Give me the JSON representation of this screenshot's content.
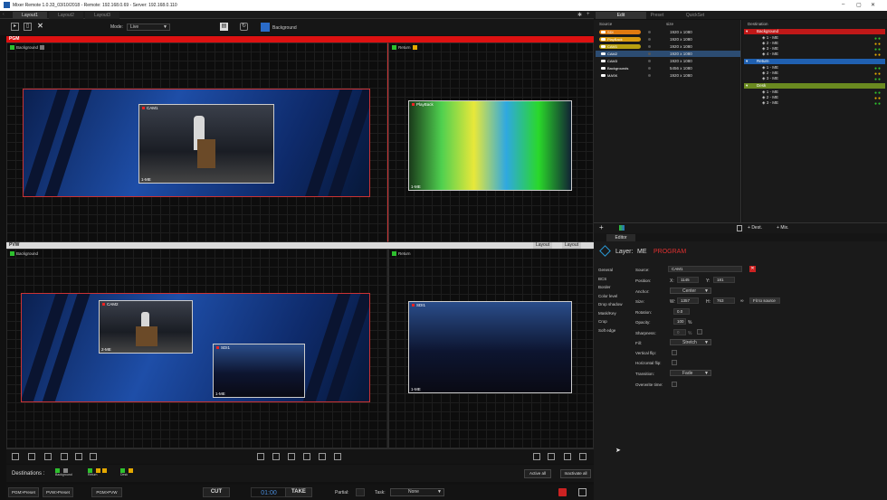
{
  "titlebar": {
    "title": "Mixer Remote 1.0.33_03/10/2018 - Remote: 192.168.0.69 - Server: 192.168.0.110",
    "minimize": "–",
    "maximize": "▢",
    "close": "✕"
  },
  "layout_tabs": [
    "Layout1",
    "Layout2",
    "Layout3"
  ],
  "right_tabs": [
    "Edit",
    "Preset",
    "QuickSet"
  ],
  "toolbar": {
    "mode_label": "Mode:",
    "mode_value": "Live",
    "bg_label": "Background"
  },
  "pgm": {
    "label": "PGM",
    "left_pane": {
      "label": "Background"
    },
    "right_pane": {
      "label": "Return"
    },
    "layers": [
      {
        "name": "CAM1",
        "me": "1-ME"
      },
      {
        "name": "PlayBack",
        "me": "1-ME"
      }
    ]
  },
  "pvw": {
    "label": "PVW",
    "layout_btn": "Layout",
    "layout_btn2": "Layout",
    "left_pane": {
      "label": "Background"
    },
    "right_pane": {
      "label": "Return"
    },
    "layers": [
      {
        "name": "CAM2",
        "me": "2-ME"
      },
      {
        "name": "SDI1",
        "me": "1-ME"
      },
      {
        "name": "SDI1",
        "me": "1-ME"
      }
    ]
  },
  "destinations_bar": {
    "label": "Destinations :",
    "items": [
      "Background",
      "Return",
      "Desk"
    ],
    "active_all": "Active all",
    "inactivate_all": "Inactivate all"
  },
  "actions": {
    "pgm_preset": "PGM>Preset",
    "pvw_preset": "PVW>Preset",
    "pgm_pvw": "PGM>PVW",
    "cut": "CUT",
    "timer": "01:00",
    "take": "TAKE",
    "partial": "Partial:",
    "task": "Task:",
    "task_value": "None"
  },
  "sources": {
    "header_source": "Source",
    "header_size": "size",
    "rows": [
      {
        "name": "SDI",
        "size": "1920 x 1080",
        "color": "#e07a10",
        "pill": true
      },
      {
        "name": "PlayBack",
        "size": "1920 x 1080",
        "color": "#d89a10",
        "pill": true
      },
      {
        "name": "CAM1",
        "size": "1920 x 1080",
        "color": "#b8a010",
        "pill": true
      },
      {
        "name": "CAM2",
        "size": "1920 x 1080",
        "color": "#2c4c72",
        "pill": false
      },
      {
        "name": "CAM3",
        "size": "1920 x 1080",
        "color": "",
        "pill": false
      },
      {
        "name": "Backgrounds",
        "size": "5456 x 1080",
        "color": "",
        "pill": false
      },
      {
        "name": "MASK",
        "size": "1920 x 1080",
        "color": "",
        "pill": false
      }
    ]
  },
  "destinations_tree": {
    "header": "Destination",
    "groups": [
      {
        "name": "Background",
        "color": "#c01818",
        "items": [
          "1 - ME",
          "2 - ME",
          "3 - ME",
          "4 - ME"
        ]
      },
      {
        "name": "Return",
        "color": "#2060b0",
        "items": [
          "1 - ME",
          "2 - ME",
          "3 - ME"
        ]
      },
      {
        "name": "Desk",
        "color": "#6a8a20",
        "items": [
          "1 - ME",
          "2 - ME",
          "3 - ME"
        ]
      }
    ]
  },
  "panel_bottom": {
    "dest_btn": "Dest.",
    "mix_btn": "Mix."
  },
  "editor_tab": "Editor",
  "editor": {
    "layer_label": "Layer:",
    "layer_me": "ME",
    "layer_state": "PROGRAM",
    "state_color": "#e03030",
    "sections": [
      "General",
      "BCS",
      "Border",
      "Color level",
      "Drop shadow",
      "Mask/Key",
      "Crop",
      "Soft edge"
    ],
    "source_label": "Source:",
    "source_value": "CAM1",
    "position_label": "Position:",
    "x_label": "X:",
    "x_value": "1145",
    "y_label": "Y:",
    "y_value": "181",
    "anchor_label": "Anchor:",
    "anchor_value": "Center",
    "size_label": "Size:",
    "w_label": "W:",
    "w_value": "1357",
    "h_label": "H:",
    "h_value": "763",
    "fit_btn": "Fit to source",
    "rotation_label": "Rotation:",
    "rotation_value": "0.0",
    "opacity_label": "Opacity:",
    "opacity_value": "100",
    "opacity_unit": "%",
    "sharpness_label": "Sharpness:",
    "sharpness_value": "0",
    "sharpness_unit": "%",
    "fill_label": "Fill:",
    "fill_value": "Stretch",
    "vflip_label": "Vertical flip:",
    "hflip_label": "Horizontal flip:",
    "transition_label": "Transition:",
    "transition_value": "Fade",
    "overwrite_label": "Overwrite time:"
  }
}
